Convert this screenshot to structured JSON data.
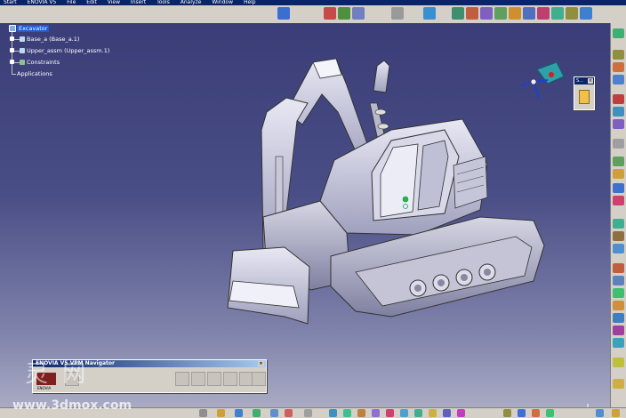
{
  "menubar": {
    "items": [
      "Start",
      "ENOVIA V5",
      "File",
      "Edit",
      "View",
      "Insert",
      "Tools",
      "Analyze",
      "Window",
      "Help"
    ]
  },
  "tree": {
    "root": "Excavator",
    "children": [
      "Base_a (Base_a.1)",
      "Upper_assm (Upper_assm.1)",
      "Constraints"
    ],
    "applications": "Applications"
  },
  "compass_window": {
    "title": "S..."
  },
  "navigator": {
    "title": "ENOVIA V5 VPM Navigator",
    "logo_label": "ENOVIA"
  },
  "watermark": {
    "chars": "灵 网",
    "url": "www.3dmox.com"
  },
  "colors": {
    "viewport_top": "#3a3d77",
    "viewport_bottom": "#a9abc4",
    "selection": "#1e5ad6",
    "titlebar": "#0a246a"
  }
}
